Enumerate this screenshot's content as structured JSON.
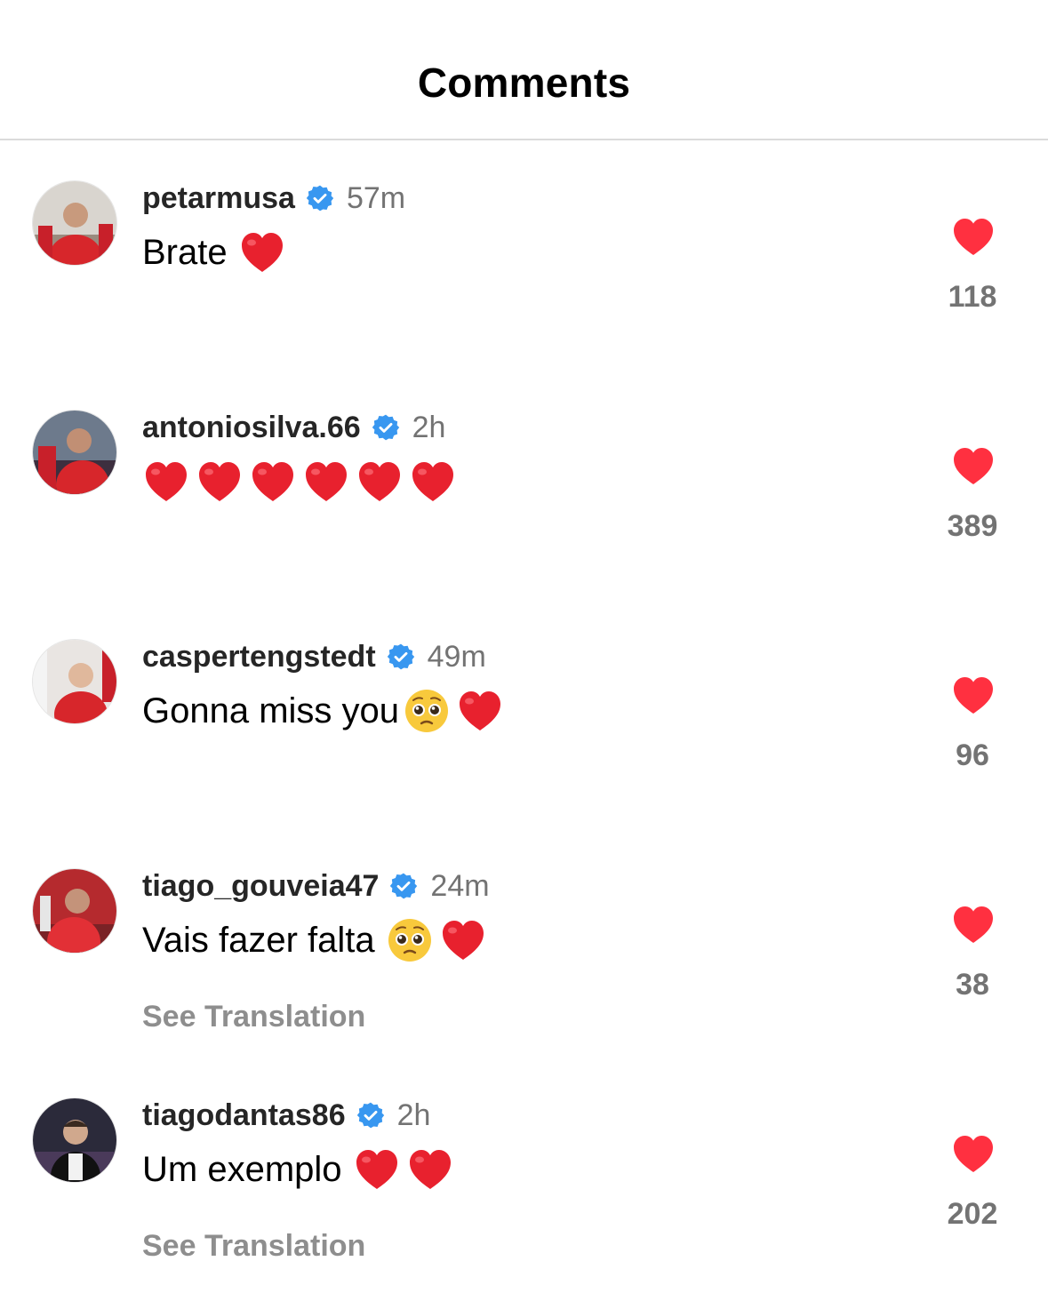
{
  "header": {
    "title": "Comments"
  },
  "comments": [
    {
      "username": "petarmusa",
      "time": "57m",
      "text": "Brate",
      "emojis": [
        "red-heart"
      ],
      "likes": "118",
      "see_translation": ""
    },
    {
      "username": "antoniosilva.66",
      "time": "2h",
      "text": "",
      "emojis": [
        "red-heart",
        "red-heart",
        "red-heart",
        "red-heart",
        "red-heart",
        "red-heart"
      ],
      "likes": "389",
      "see_translation": ""
    },
    {
      "username": "caspertengstedt",
      "time": "49m",
      "text": "Gonna miss you",
      "emojis": [
        "pleading-face",
        "red-heart"
      ],
      "likes": "96",
      "see_translation": ""
    },
    {
      "username": "tiago_gouveia47",
      "time": "24m",
      "text": "Vais fazer falta",
      "emojis": [
        "pleading-face",
        "red-heart"
      ],
      "likes": "38",
      "see_translation": "See Translation"
    },
    {
      "username": "tiagodantas86",
      "time": "2h",
      "text": "Um exemplo",
      "emojis": [
        "red-heart",
        "red-heart"
      ],
      "likes": "202",
      "see_translation": "See Translation"
    }
  ],
  "colors": {
    "like_red": "#ff3040",
    "verified_blue": "#3897f0",
    "secondary_text": "#737373"
  },
  "icons": {
    "verified": "verified-badge-icon",
    "like": "heart-filled-icon",
    "emoji_heart": "red-heart-emoji",
    "emoji_pleading": "pleading-face-emoji"
  }
}
